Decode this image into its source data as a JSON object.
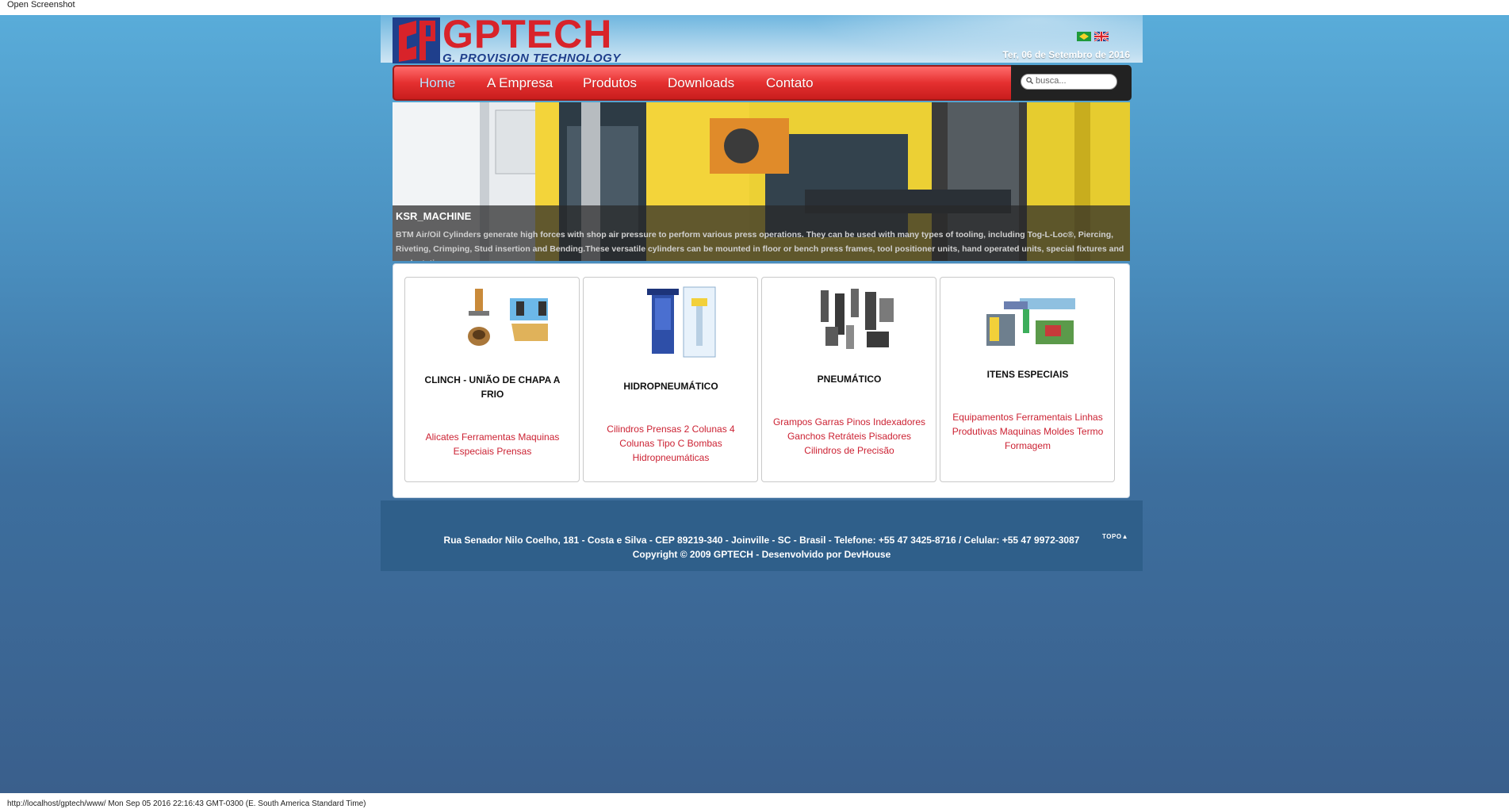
{
  "browser": {
    "top_label": "Open Screenshot",
    "status_text": "http://localhost/gptech/www/ Mon Sep 05 2016 22:16:43 GMT-0300 (E. South America Standard Time)"
  },
  "header": {
    "logo_title": "GPTECH",
    "logo_subtitle": "G. PROVISION TECHNOLOGY",
    "date": "Ter, 06 de Setembro de 2016",
    "flags": [
      "brazil-flag-icon",
      "uk-flag-icon"
    ]
  },
  "nav": {
    "items": [
      {
        "label": "Home",
        "active": true
      },
      {
        "label": "A Empresa",
        "active": false
      },
      {
        "label": "Produtos",
        "active": false
      },
      {
        "label": "Downloads",
        "active": false
      },
      {
        "label": "Contato",
        "active": false
      }
    ],
    "search_placeholder": "busca..."
  },
  "banner": {
    "title": "KSR_MACHINE",
    "text": "BTM Air/Oil Cylinders generate high forces with shop air pressure to perform various press operations. They can be used with many types of tooling, including Tog-L-Loc®, Piercing, Riveting, Crimping, Stud insertion and Bending.These versatile cylinders can be mounted in floor or bench press frames, tool positioner units, hand operated units, special fixtures and work station."
  },
  "products": [
    {
      "title": "CLINCH - UNIÃO DE CHAPA A FRIO",
      "links": "Alicates Ferramentas Maquinas Especiais Prensas"
    },
    {
      "title": "HIDROPNEUMÁTICO",
      "links": "Cilindros Prensas 2 Colunas 4 Colunas Tipo C Bombas Hidropneumáticas"
    },
    {
      "title": "PNEUMÁTICO",
      "links": "Grampos Garras Pinos Indexadores Ganchos Retráteis Pisadores Cilindros de Precisão"
    },
    {
      "title": "ITENS ESPECIAIS",
      "links": "Equipamentos Ferramentais Linhas Produtivas Maquinas Moldes Termo Formagem"
    }
  ],
  "footer": {
    "address": "Rua Senador Nilo Coelho, 181 - Costa e Silva - CEP 89219-340 - Joinville - SC - Brasil - Telefone: +55 47 3425-8716 / Celular: +55 47 9972-3087",
    "copyright": "Copyright © 2009 GPTECH - Desenvolvido por DevHouse",
    "top_link": "TOPO"
  },
  "colors": {
    "brand_red": "#d8232a",
    "brand_blue": "#1f3f8c",
    "link_red": "#cc2233",
    "footer_blue": "#2f5f8a"
  }
}
